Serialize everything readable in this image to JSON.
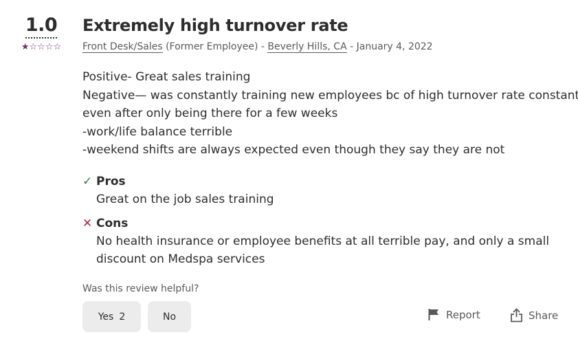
{
  "review": {
    "rating": "1.0",
    "stars_filled": 1,
    "stars_total": 5,
    "title": "Extremely high turnover rate",
    "job_title": "Front Desk/Sales",
    "employment_status": "(Former Employee)",
    "sep1": " - ",
    "location": "Beverly Hills, CA",
    "sep2": " - ",
    "date": "January 4, 2022",
    "body_lines": [
      "Positive- Great sales training",
      "Negative— was constantly training new employees bc of high turnover rate constantly",
      "even after only being there for a few weeks",
      "-work/life balance terrible",
      "-weekend shifts are always expected even though they say they are not"
    ],
    "pros_label": "Pros",
    "pros_text": "Great on the job sales training",
    "cons_label": "Cons",
    "cons_lines": [
      "No health insurance or employee benefits at all terrible pay, and only a small",
      "discount on Medspa services"
    ]
  },
  "helpful": {
    "question": "Was this review helpful?",
    "yes_label": "Yes",
    "yes_count": "2",
    "no_label": "No"
  },
  "actions": {
    "report_label": "Report",
    "share_label": "Share"
  },
  "colors": {
    "star": "#7a2b6c",
    "pros_icon": "#3b7a3b",
    "cons_icon": "#a82b3e",
    "button_bg": "#ececec"
  },
  "icons": {
    "star_filled": "star-filled-icon",
    "star_empty": "star-empty-icon",
    "pros": "check-icon",
    "cons": "x-icon",
    "report": "flag-icon",
    "share": "share-icon"
  }
}
